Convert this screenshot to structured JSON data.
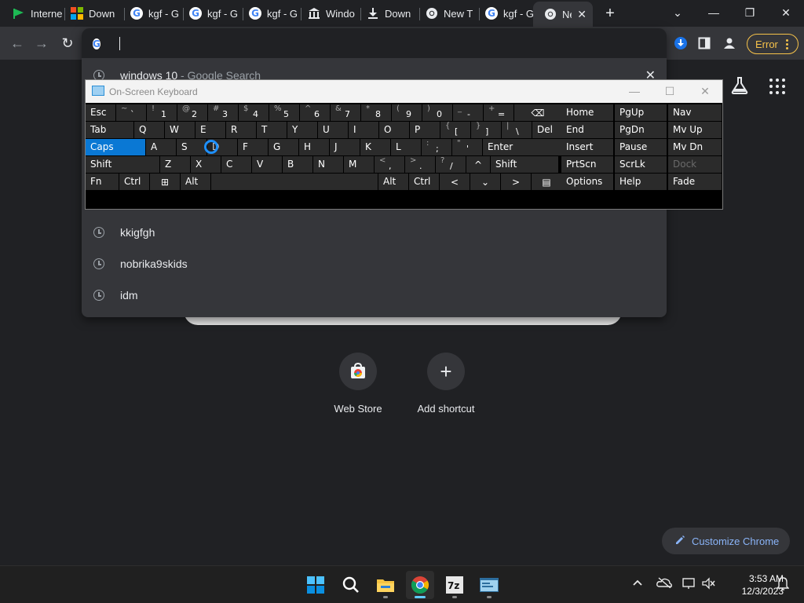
{
  "browser": {
    "tabs": [
      {
        "title": "Interne",
        "favicon": "green-flag-icon"
      },
      {
        "title": "Down",
        "favicon": "microsoft-logo-icon"
      },
      {
        "title": "kgf - G",
        "favicon": "google-icon"
      },
      {
        "title": "kgf - G",
        "favicon": "google-icon"
      },
      {
        "title": "kgf - G",
        "favicon": "google-icon"
      },
      {
        "title": "Windo",
        "favicon": "building-icon"
      },
      {
        "title": "Down",
        "favicon": "download-icon"
      },
      {
        "title": "New T",
        "favicon": "chrome-icon"
      },
      {
        "title": "kgf - G",
        "favicon": "google-icon"
      },
      {
        "title": "Ne",
        "favicon": "chrome-icon",
        "active": true
      }
    ],
    "new_tab": "+",
    "window_controls": {
      "dropdown": "⌄",
      "minimize": "—",
      "restore": "❐",
      "close": "✕"
    },
    "toolbar": {
      "back": "←",
      "forward": "→",
      "reload": "↻",
      "error_label": "Error"
    },
    "omnibox": {
      "google_glyph": "G",
      "suggestions": [
        {
          "text": "windows 10",
          "sub": " - Google Search"
        },
        {
          "text": "kkigfgh"
        },
        {
          "text": "nobrika9skids"
        },
        {
          "text": "idm"
        }
      ],
      "remove": "✕"
    }
  },
  "ntp": {
    "shortcuts": [
      {
        "label": "Web Store"
      },
      {
        "label": "Add shortcut",
        "glyph": "+"
      }
    ],
    "customize_label": "Customize Chrome"
  },
  "osk": {
    "title": "On-Screen Keyboard",
    "controls": {
      "minimize": "—",
      "maximize": "☐",
      "close": "✕"
    },
    "rows": [
      [
        {
          "t": "Esc"
        },
        {
          "s": "~",
          "p": "`"
        },
        {
          "s": "!",
          "p": "1"
        },
        {
          "s": "@",
          "p": "2"
        },
        {
          "s": "#",
          "p": "3"
        },
        {
          "s": "$",
          "p": "4"
        },
        {
          "s": "%",
          "p": "5"
        },
        {
          "s": "^",
          "p": "6"
        },
        {
          "s": "&",
          "p": "7"
        },
        {
          "s": "*",
          "p": "8"
        },
        {
          "s": "(",
          "p": "9"
        },
        {
          "s": ")",
          "p": "0"
        },
        {
          "s": "_",
          "p": "-"
        },
        {
          "s": "+",
          "p": "="
        },
        {
          "t": "⌫"
        }
      ],
      [
        {
          "t": "Tab"
        },
        {
          "t": "Q"
        },
        {
          "t": "W"
        },
        {
          "t": "E"
        },
        {
          "t": "R"
        },
        {
          "t": "T"
        },
        {
          "t": "Y"
        },
        {
          "t": "U"
        },
        {
          "t": "I"
        },
        {
          "t": "O"
        },
        {
          "t": "P"
        },
        {
          "s": "{",
          "p": "["
        },
        {
          "s": "}",
          "p": "]"
        },
        {
          "s": "|",
          "p": "\\"
        },
        {
          "t": "Del"
        }
      ],
      [
        {
          "t": "Caps"
        },
        {
          "t": "A"
        },
        {
          "t": "S"
        },
        {
          "t": "D"
        },
        {
          "t": "F"
        },
        {
          "t": "G"
        },
        {
          "t": "H"
        },
        {
          "t": "J"
        },
        {
          "t": "K"
        },
        {
          "t": "L"
        },
        {
          "s": ":",
          "p": ";"
        },
        {
          "s": "\"",
          "p": "'"
        },
        {
          "t": "Enter"
        }
      ],
      [
        {
          "t": "Shift"
        },
        {
          "t": "Z"
        },
        {
          "t": "X"
        },
        {
          "t": "C"
        },
        {
          "t": "V"
        },
        {
          "t": "B"
        },
        {
          "t": "N"
        },
        {
          "t": "M"
        },
        {
          "s": "<",
          "p": ","
        },
        {
          "s": ">",
          "p": "."
        },
        {
          "s": "?",
          "p": "/"
        },
        {
          "t": "^"
        },
        {
          "t": "Shift"
        }
      ],
      [
        {
          "t": "Fn"
        },
        {
          "t": "Ctrl"
        },
        {
          "t": "⊞"
        },
        {
          "t": "Alt"
        },
        {
          "t": ""
        },
        {
          "t": "Alt"
        },
        {
          "t": "Ctrl"
        },
        {
          "t": "<"
        },
        {
          "t": "⌄"
        },
        {
          "t": ">"
        },
        {
          "t": "▤"
        }
      ]
    ],
    "nav_keys": [
      [
        "Home",
        "PgUp",
        "Nav"
      ],
      [
        "End",
        "PgDn",
        "Mv Up"
      ],
      [
        "Insert",
        "Pause",
        "Mv Dn"
      ],
      [
        "PrtScn",
        "ScrLk",
        "Dock"
      ],
      [
        "Options",
        "Help",
        "Fade"
      ]
    ],
    "selected_key": "Caps",
    "disabled_key": "Dock"
  },
  "taskbar": {
    "apps": [
      "windows-start-icon",
      "search-icon",
      "file-explorer-icon",
      "chrome-icon",
      "7zip-icon",
      "terminal-icon"
    ],
    "clock": {
      "time": "3:53 AM",
      "date": "12/3/2023"
    }
  },
  "colors": {
    "accent": "#0a78d4",
    "error": "#f6c24a",
    "link": "#8ab4f8"
  }
}
